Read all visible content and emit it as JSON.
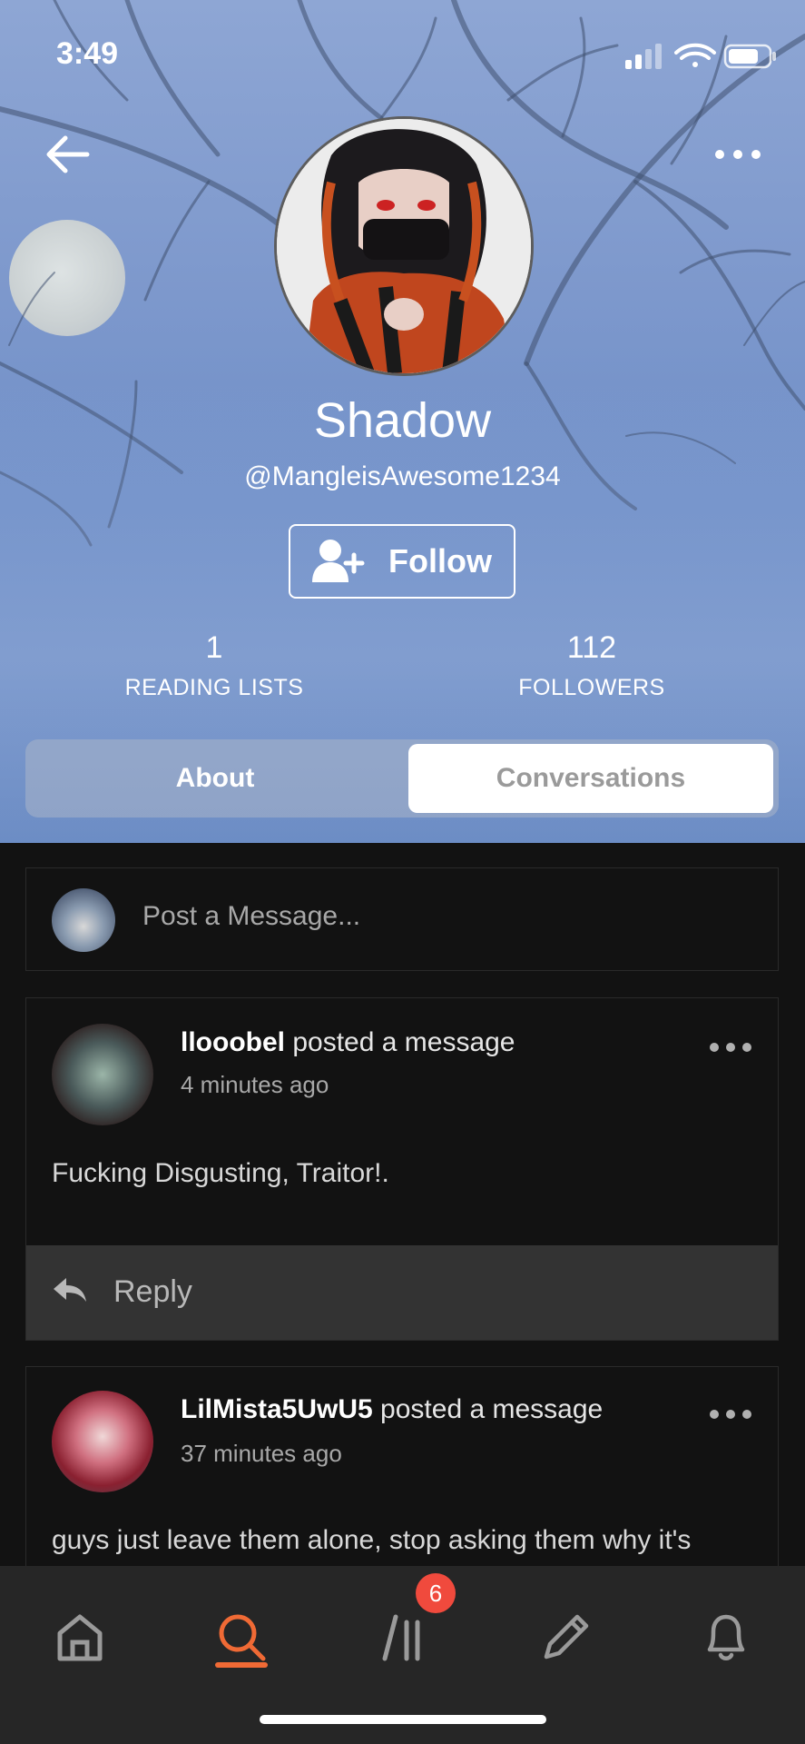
{
  "status_bar": {
    "time": "3:49"
  },
  "profile": {
    "display_name": "Shadow",
    "handle": "@MangleisAwesome1234",
    "follow_label": "Follow",
    "stats": [
      {
        "value": "1",
        "label": "READING LISTS"
      },
      {
        "value": "112",
        "label": "FOLLOWERS"
      }
    ]
  },
  "tabs": {
    "about": "About",
    "conversations": "Conversations",
    "active": "Conversations"
  },
  "composer": {
    "placeholder": "Post a Message..."
  },
  "posts": [
    {
      "author": "llooobel",
      "action": " posted a message",
      "time": "4 minutes ago",
      "body": "Fucking Disgusting, Traitor!."
    },
    {
      "author": "LilMista5UwU5",
      "action": " posted a message",
      "time": "37 minutes ago",
      "body": "guys just leave them alone, stop asking them why it's"
    }
  ],
  "reply_label": "Reply",
  "bottom_nav": {
    "items": [
      "home-icon",
      "search-icon",
      "library-icon",
      "write-icon",
      "notifications-icon"
    ],
    "active": "search-icon",
    "library_badge": "6"
  },
  "colors": {
    "accent": "#f06a35",
    "badge": "#f04a3d",
    "feed_bg": "#121212"
  }
}
